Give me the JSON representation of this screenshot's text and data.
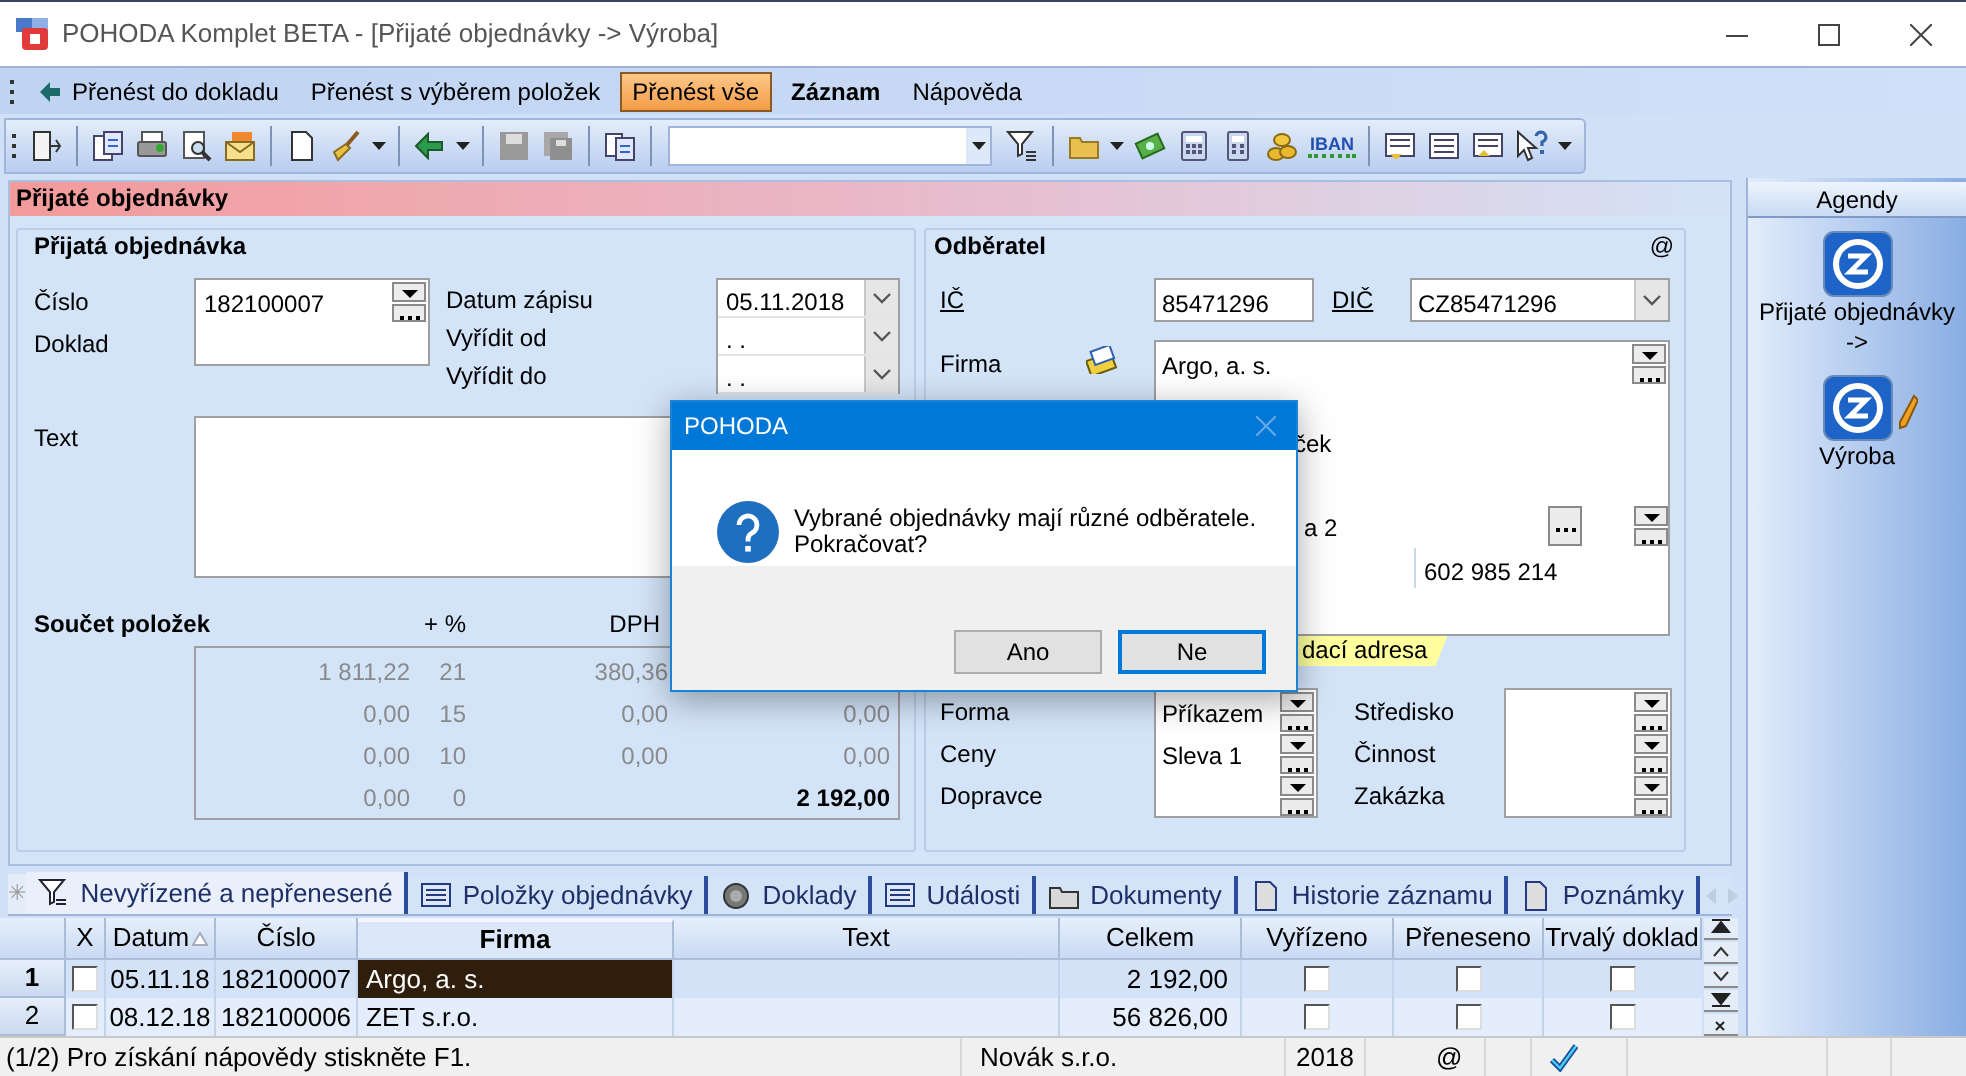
{
  "window": {
    "title": "POHODA Komplet BETA - [Přijaté objednávky -> Výroba]"
  },
  "menu": [
    {
      "label": "Přenést do dokladu",
      "kind": "arrow",
      "selected": false
    },
    {
      "label": "Přenést s výběrem položek",
      "kind": "plain",
      "selected": false
    },
    {
      "label": "Přenést vše",
      "kind": "plain",
      "selected": true
    },
    {
      "label": "Záznam",
      "kind": "bold",
      "selected": false
    },
    {
      "label": "Nápověda",
      "kind": "plain",
      "selected": false
    }
  ],
  "toolbar": {
    "iban": "IBAN"
  },
  "section_title": "Přijaté objednávky",
  "order": {
    "title": "Přijatá objednávka",
    "number_label": "Číslo",
    "number": "182100007",
    "document_label": "Doklad",
    "date_rows": [
      {
        "label": "Datum zápisu",
        "value": "05.11.2018"
      },
      {
        "label": "Vyřídit od",
        "value": ". ."
      },
      {
        "label": "Vyřídit do",
        "value": ". ."
      }
    ],
    "text_label": "Text"
  },
  "totals": {
    "title": "Součet položek",
    "rate_header": "+ %",
    "vat_header": "DPH",
    "rows": [
      {
        "kind": "rate",
        "base": "1 811,22",
        "rate": "21",
        "vat": "380,36"
      },
      {
        "kind": "rate",
        "base": "0,00",
        "rate": "15",
        "vat": "0,00",
        "total": "0,00"
      },
      {
        "kind": "rate",
        "base": "0,00",
        "rate": "10",
        "vat": "0,00",
        "total": "0,00"
      },
      {
        "kind": "sum",
        "base": "0,00",
        "rate": "0",
        "total": "2 192,00"
      }
    ]
  },
  "customer": {
    "title": "Odběratel",
    "email_mark": "@",
    "ico_label": "IČ",
    "ico": "85471296",
    "dic_label": "DIČ",
    "dic": "CZ85471296",
    "company_label": "Firma",
    "company": "Argo, a. s.",
    "company_fragments": [
      "ček",
      "a 2"
    ],
    "phone": "602 985 214",
    "address_tab": "dací adresa",
    "payment": [
      {
        "label": "Forma",
        "value": "Příkazem"
      },
      {
        "label": "Ceny",
        "value": "Sleva 1"
      },
      {
        "label": "Dopravce"
      }
    ],
    "assignment": [
      {
        "label": "Středisko"
      },
      {
        "label": "Činnost"
      },
      {
        "label": "Zakázka"
      }
    ]
  },
  "agendas": {
    "title": "Agendy",
    "items": [
      {
        "label": "Přijaté objednávky ->",
        "kind": "plain"
      },
      {
        "label": "Výroba",
        "kind": "edit"
      }
    ]
  },
  "dialog": {
    "title": "POHODA",
    "message": "Vybrané objednávky mají různé odběratele. Pokračovat?",
    "buttons": [
      {
        "label": "Ano",
        "selected": false
      },
      {
        "label": "Ne",
        "selected": true
      }
    ]
  },
  "grid": {
    "tabs": [
      {
        "label": "✳",
        "kind": "star",
        "selected": false
      },
      {
        "label": "Nevyřízené a nepřenesené",
        "kind": "filter",
        "selected": true
      },
      {
        "label": "Položky objednávky",
        "kind": "list",
        "selected": false
      },
      {
        "label": "Doklady",
        "kind": "circle",
        "selected": false
      },
      {
        "label": "Události",
        "kind": "list",
        "selected": false
      },
      {
        "label": "Dokumenty",
        "kind": "folder",
        "selected": false
      },
      {
        "label": "Historie záznamu",
        "kind": "page",
        "selected": false
      },
      {
        "label": "Poznámky",
        "kind": "page",
        "selected": false
      }
    ],
    "columns": [
      {
        "label": "X",
        "sorted": false,
        "selected": false
      },
      {
        "label": "Datum",
        "sorted": true,
        "selected": false
      },
      {
        "label": "Číslo",
        "sorted": false,
        "selected": false
      },
      {
        "label": "Firma",
        "sorted": false,
        "selected": true
      },
      {
        "label": "Text",
        "sorted": false,
        "selected": false
      },
      {
        "label": "Celkem",
        "sorted": false,
        "selected": false
      },
      {
        "label": "Vyřízeno",
        "sorted": false,
        "selected": false
      },
      {
        "label": "Přeneseno",
        "sorted": false,
        "selected": false
      },
      {
        "label": "Trvalý doklad",
        "sorted": false,
        "selected": false
      }
    ],
    "rows": [
      {
        "row": "1",
        "selected": true,
        "x": false,
        "date": "05.11.18",
        "number": "182100007",
        "company": "Argo, a. s.",
        "total": "2 192,00",
        "done": false,
        "transferred": false,
        "permanent": false
      },
      {
        "row": "2",
        "selected": false,
        "x": false,
        "date": "08.12.18",
        "number": "182100006",
        "company": "ZET s.r.o.",
        "total": "56 826,00",
        "done": false,
        "transferred": false,
        "permanent": false
      }
    ]
  },
  "status_bar": {
    "message": "(1/2) Pro získání nápovědy stiskněte F1.",
    "company": "Novák s.r.o.",
    "year": "2018",
    "email": "@"
  }
}
